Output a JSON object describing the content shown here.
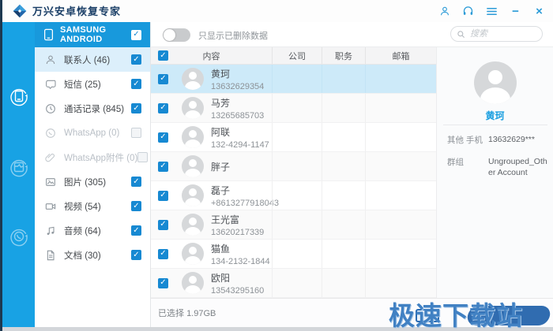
{
  "colors": {
    "accent_blue": "#18a2e4",
    "device_header_blue": "#1899dc",
    "checkbox_blue": "#1789d2",
    "selected_row_bg": "#cdeaf9",
    "active_category_bg": "#dceffb",
    "detail_name_blue": "#1a9fe0",
    "watermark_blue": "#4181c3"
  },
  "titlebar": {
    "app_title": "万兴安卓恢复专家"
  },
  "icons": {
    "titlebar": [
      "account-icon",
      "support-headset-icon",
      "menu-icon",
      "minimize-icon",
      "close-icon"
    ],
    "nav_rail": [
      "android-data-recovery-icon",
      "broken-device-recovery-icon",
      "whatsapp-recovery-icon"
    ],
    "categories": [
      "contacts-icon",
      "sms-icon",
      "call-history-icon",
      "whatsapp-icon",
      "attachment-icon",
      "photos-icon",
      "videos-icon",
      "audio-icon",
      "documents-icon"
    ]
  },
  "device": {
    "name": "SAMSUNG ANDROID",
    "checked": true
  },
  "toolbar": {
    "deleted_toggle_label": "只显示已删除数据",
    "toggle_on": false,
    "search_placeholder": "搜索"
  },
  "categories": [
    {
      "label": "联系人 (46)",
      "checked": true,
      "active": true
    },
    {
      "label": "短信 (25)",
      "checked": true
    },
    {
      "label": "通话记录 (845)",
      "checked": true
    },
    {
      "label": "WhatsApp (0)",
      "checked": false,
      "disabled": true
    },
    {
      "label": "WhatsApp附件 (0)",
      "checked": false,
      "disabled": true
    },
    {
      "label": "图片 (305)",
      "checked": true
    },
    {
      "label": "视频 (54)",
      "checked": true
    },
    {
      "label": "音频 (64)",
      "checked": true
    },
    {
      "label": "文档 (30)",
      "checked": true
    }
  ],
  "table": {
    "headers": [
      "内容",
      "公司",
      "职务",
      "邮箱"
    ],
    "header_checkbox_checked": true,
    "rows": [
      {
        "name": "黄珂",
        "phone": "13632629354",
        "checked": true,
        "selected": true
      },
      {
        "name": "马芳",
        "phone": "13265685703",
        "checked": true
      },
      {
        "name": "阿联",
        "phone": "132-4294-1147",
        "checked": true
      },
      {
        "name": "胖子",
        "phone": "",
        "checked": true
      },
      {
        "name": "磊子",
        "phone": "+8613277918043",
        "checked": true
      },
      {
        "name": "王光富",
        "phone": "13620217339",
        "checked": true
      },
      {
        "name": "猫鱼",
        "phone": "134-2132-1844",
        "checked": true
      },
      {
        "name": "欧阳",
        "phone": "13543295160",
        "checked": true
      }
    ]
  },
  "detail": {
    "name": "黄珂",
    "fields": [
      {
        "label": "其他 手机",
        "value": "13632629***"
      },
      {
        "label": "群组",
        "value": "Ungrouped_Other Account"
      }
    ]
  },
  "statusbar": {
    "label": "已选择",
    "size": "1.97GB"
  },
  "watermark": {
    "text": "极速下载站"
  }
}
